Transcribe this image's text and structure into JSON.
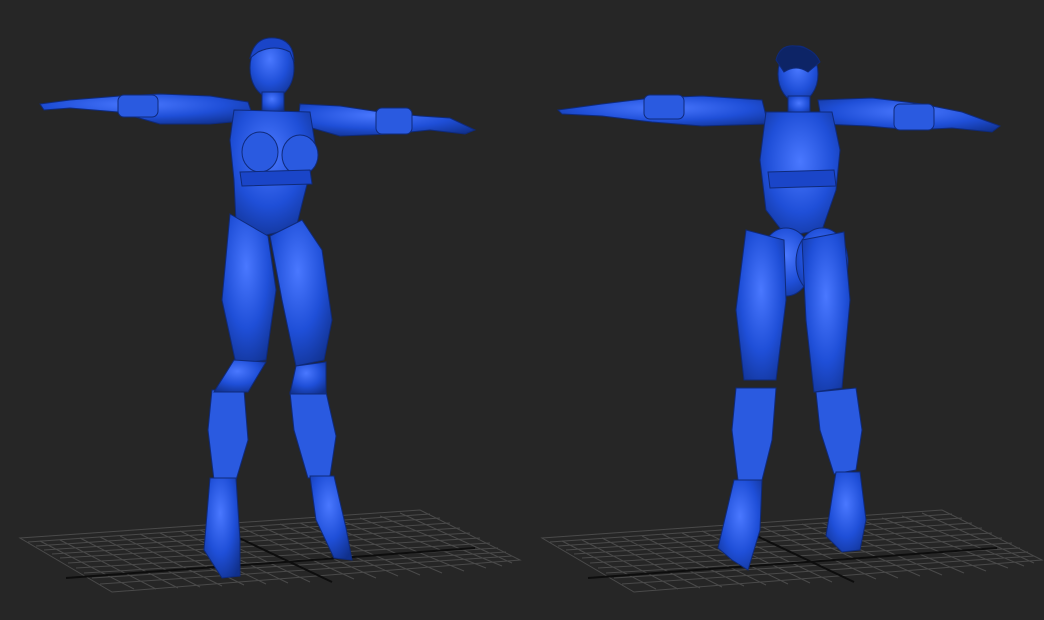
{
  "scene": {
    "background_color": "#262626",
    "grid_color": "#4a4a4a",
    "grid_axis_color": "#0d0d0d",
    "model_color": "#1f4fd8",
    "model_shadow_color": "#12338f",
    "model_highlight_color": "#5a86ff"
  },
  "viewports": [
    {
      "view": "front"
    },
    {
      "view": "back"
    }
  ]
}
